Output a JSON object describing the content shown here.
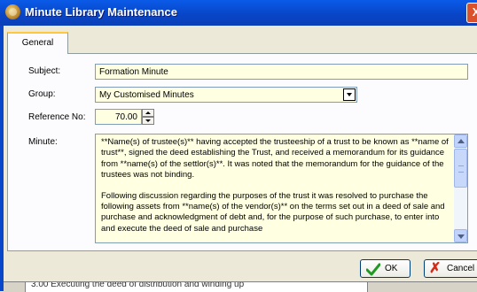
{
  "window": {
    "title": "Minute Library Maintenance",
    "close_glyph": "X"
  },
  "tabs": [
    {
      "label": "General",
      "active": true
    }
  ],
  "form": {
    "subject": {
      "label": "Subject:",
      "value": "Formation Minute"
    },
    "group": {
      "label": "Group:",
      "value": "My Customised Minutes"
    },
    "reference": {
      "label": "Reference No:",
      "value": "70.00"
    },
    "minute": {
      "label": "Minute:",
      "paragraphs": [
        "**Name(s) of trustee(s)** having accepted the trusteeship of a trust to be known as **name of trust**, signed the deed establishing the Trust, and received a memorandum for its guidance from **name(s) of the settlor(s)**. It was noted that the memorandum for the guidance of the trustees was not binding.",
        "Following discussion regarding the purposes of the trust it was resolved to purchase the following assets from **name(s) of the vendor(s)** on the terms set out in a deed of sale and purchase and acknowledgment of debt and, for the purpose of such purchase, to enter into and execute the deed of sale and purchase"
      ]
    }
  },
  "buttons": {
    "ok": "OK",
    "cancel": "Cancel"
  },
  "background_window": {
    "row_text": "3.00 Executing the deed of distribution and winding up"
  },
  "colors": {
    "titlebar": "#0846C8",
    "field_background": "#FFFFE1",
    "dialog_background": "#ECE9D8",
    "close_button": "#D9522C"
  },
  "icons": {
    "app": "coin-icon",
    "ok": "checkmark-icon",
    "cancel": "red-x-icon"
  }
}
